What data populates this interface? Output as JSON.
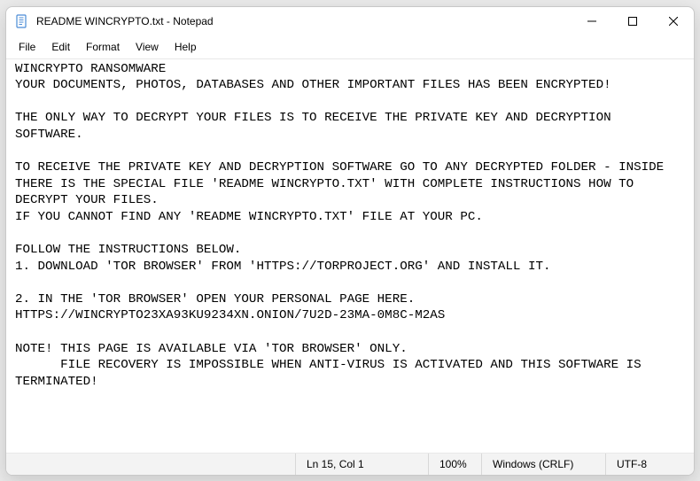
{
  "window": {
    "title": "README WINCRYPTO.txt - Notepad"
  },
  "menu": {
    "file": "File",
    "edit": "Edit",
    "format": "Format",
    "view": "View",
    "help": "Help"
  },
  "content": "WINCRYPTO RANSOMWARE\nYOUR DOCUMENTS, PHOTOS, DATABASES AND OTHER IMPORTANT FILES HAS BEEN ENCRYPTED!\n\nTHE ONLY WAY TO DECRYPT YOUR FILES IS TO RECEIVE THE PRIVATE KEY AND DECRYPTION SOFTWARE.\n\nTO RECEIVE THE PRIVATE KEY AND DECRYPTION SOFTWARE GO TO ANY DECRYPTED FOLDER - INSIDE\nTHERE IS THE SPECIAL FILE 'README WINCRYPTO.TXT' WITH COMPLETE INSTRUCTIONS HOW TO DECRYPT YOUR FILES.\nIF YOU CANNOT FIND ANY 'README WINCRYPTO.TXT' FILE AT YOUR PC.\n\nFOLLOW THE INSTRUCTIONS BELOW.\n1. DOWNLOAD 'TOR BROWSER' FROM 'HTTPS://TORPROJECT.ORG' AND INSTALL IT.\n\n2. IN THE 'TOR BROWSER' OPEN YOUR PERSONAL PAGE HERE.\nHTTPS://WINCRYPTO23XA93KU9234XN.ONION/7U2D-23MA-0M8C-M2AS\n\nNOTE! THIS PAGE IS AVAILABLE VIA 'TOR BROWSER' ONLY.\n      FILE RECOVERY IS IMPOSSIBLE WHEN ANTI-VIRUS IS ACTIVATED AND THIS SOFTWARE IS TERMINATED!",
  "status": {
    "position": "Ln 15, Col 1",
    "zoom": "100%",
    "line_ending": "Windows (CRLF)",
    "encoding": "UTF-8"
  }
}
